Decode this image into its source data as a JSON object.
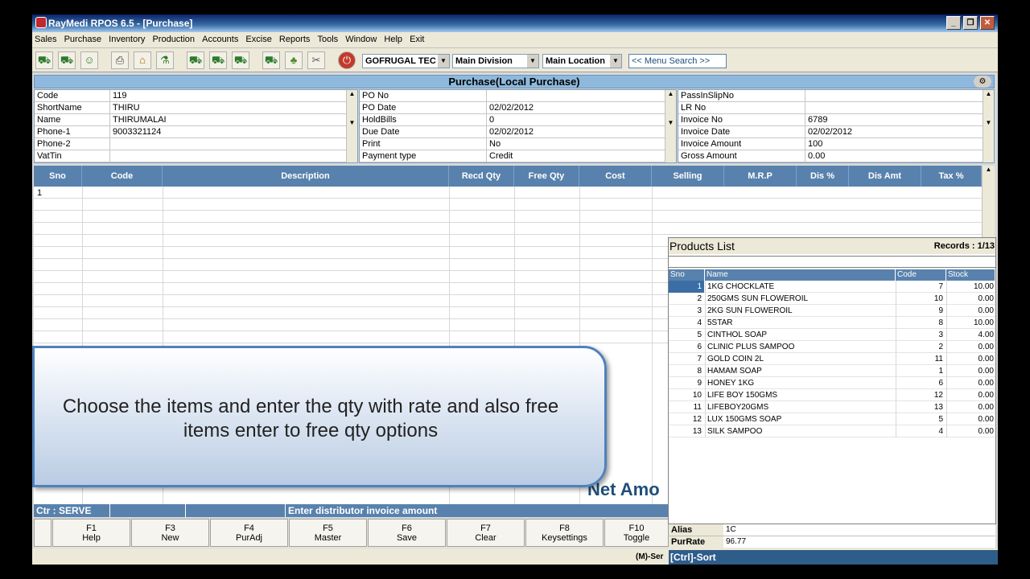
{
  "window": {
    "title": "RayMedi RPOS 6.5 - [Purchase]"
  },
  "menu": [
    "Sales",
    "Purchase",
    "Inventory",
    "Production",
    "Accounts",
    "Excise",
    "Reports",
    "Tools",
    "Window",
    "Help",
    "Exit"
  ],
  "toolbar": {
    "company": "GOFRUGAL TEC",
    "division": "Main Division",
    "location": "Main Location",
    "search": "<< Menu Search >>"
  },
  "form": {
    "title": "Purchase(Local Purchase)"
  },
  "supplier": {
    "labels": [
      "Code",
      "ShortName",
      "Name",
      "Phone-1",
      "Phone-2",
      "VatTin"
    ],
    "values": [
      "119",
      "THIRU",
      "THIRUMALAI",
      "9003321124",
      "",
      ""
    ]
  },
  "order": {
    "labels": [
      "PO No",
      "PO Date",
      "HoldBills",
      "Due Date",
      "Print",
      "Payment type"
    ],
    "values": [
      "",
      "02/02/2012",
      "0",
      "02/02/2012",
      "No",
      "Credit"
    ]
  },
  "invoice": {
    "labels": [
      "PassInSlipNo",
      "LR No",
      "Invoice No",
      "Invoice Date",
      "Invoice Amount",
      "Gross Amount"
    ],
    "values": [
      "",
      "",
      "6789",
      "02/02/2012",
      "100",
      "0.00"
    ]
  },
  "grid": {
    "columns": [
      "Sno",
      "Code",
      "Description",
      "Recd Qty",
      "Free Qty",
      "Cost",
      "Selling",
      "M.R.P",
      "Dis %",
      "Dis Amt",
      "Tax %"
    ],
    "first_sno": "1"
  },
  "callout": {
    "text": "Choose the items and enter the qty with rate and also free items enter to free qty options"
  },
  "net_amount_label": "Net Amo",
  "status": {
    "counter": "Ctr : SERVE",
    "message": "Enter distributor invoice amount"
  },
  "fkeys": [
    {
      "key": "F1",
      "label": "Help"
    },
    {
      "key": "F3",
      "label": "New"
    },
    {
      "key": "F4",
      "label": "PurAdj"
    },
    {
      "key": "F5",
      "label": "Master"
    },
    {
      "key": "F6",
      "label": "Save"
    },
    {
      "key": "F7",
      "label": "Clear"
    },
    {
      "key": "F8",
      "label": "Keysettings"
    },
    {
      "key": "F10",
      "label": "Toggle"
    }
  ],
  "bottom_hint": "(M)-Ser",
  "products": {
    "title": "Products List",
    "records": "Records : 1/13",
    "columns": [
      "Sno",
      "Name",
      "Code",
      "Stock"
    ],
    "rows": [
      {
        "sno": "1",
        "name": "1KG CHOCKLATE",
        "code": "7",
        "stock": "10.00"
      },
      {
        "sno": "2",
        "name": "250GMS SUN FLOWEROIL",
        "code": "10",
        "stock": "0.00"
      },
      {
        "sno": "3",
        "name": "2KG SUN FLOWEROIL",
        "code": "9",
        "stock": "0.00"
      },
      {
        "sno": "4",
        "name": "5STAR",
        "code": "8",
        "stock": "10.00"
      },
      {
        "sno": "5",
        "name": "CINTHOL SOAP",
        "code": "3",
        "stock": "4.00"
      },
      {
        "sno": "6",
        "name": "CLINIC PLUS SAMPOO",
        "code": "2",
        "stock": "0.00"
      },
      {
        "sno": "7",
        "name": "GOLD COIN 2L",
        "code": "11",
        "stock": "0.00"
      },
      {
        "sno": "8",
        "name": "HAMAM SOAP",
        "code": "1",
        "stock": "0.00"
      },
      {
        "sno": "9",
        "name": "HONEY 1KG",
        "code": "6",
        "stock": "0.00"
      },
      {
        "sno": "10",
        "name": "LIFE BOY 150GMS",
        "code": "12",
        "stock": "0.00"
      },
      {
        "sno": "11",
        "name": "LIFEBOY20GMS",
        "code": "13",
        "stock": "0.00"
      },
      {
        "sno": "12",
        "name": "LUX 150GMS SOAP",
        "code": "5",
        "stock": "0.00"
      },
      {
        "sno": "13",
        "name": "SILK SAMPOO",
        "code": "4",
        "stock": "0.00"
      }
    ],
    "alias_label": "Alias",
    "alias_value": "1C",
    "purrate_label": "PurRate",
    "purrate_value": "96.77",
    "sort_hint": "[Ctrl]-Sort"
  },
  "colors": {
    "header_blue": "#5882ad",
    "title_blue": "#8eb9dc",
    "selected_row": "#3a6ea5"
  }
}
